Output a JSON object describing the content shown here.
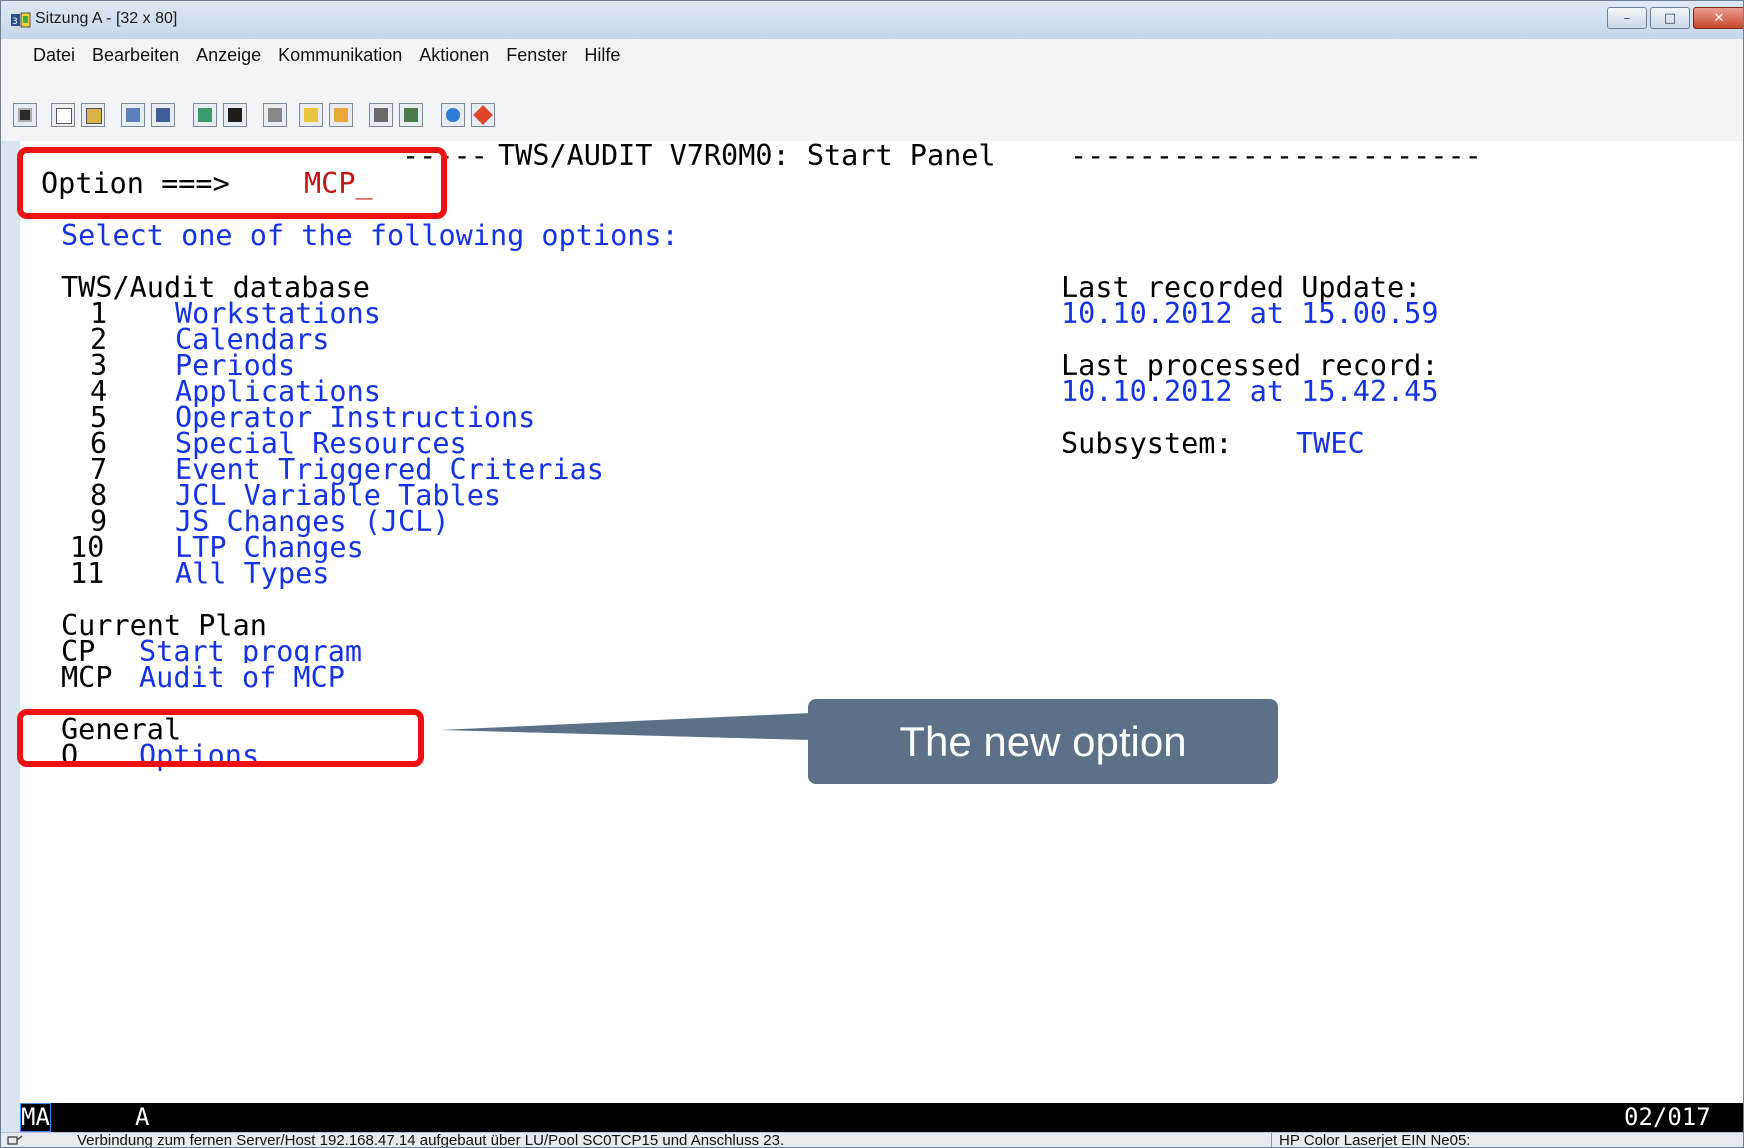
{
  "window": {
    "title": "Sitzung A - [32 x 80]",
    "buttons": {
      "minimize": "–",
      "maximize": "□",
      "close": "✕"
    }
  },
  "menu": [
    "Datei",
    "Bearbeiten",
    "Anzeige",
    "Kommunikation",
    "Aktionen",
    "Fenster",
    "Hilfe"
  ],
  "terminal": {
    "header_dashes_left": "-----",
    "panel_title": "TWS/AUDIT V7R0M0: Start Panel",
    "header_dashes_right": "------------------------",
    "option_label": "Option ===>",
    "option_value": "MCP_",
    "instruction": "Select one of the following options:",
    "db_section": "TWS/Audit database",
    "db_items": [
      {
        "num": "1",
        "label": "Workstations"
      },
      {
        "num": "2",
        "label": "Calendars"
      },
      {
        "num": "3",
        "label": "Periods"
      },
      {
        "num": "4",
        "label": "Applications"
      },
      {
        "num": "5",
        "label": "Operator Instructions"
      },
      {
        "num": "6",
        "label": "Special Resources"
      },
      {
        "num": "7",
        "label": "Event Triggered Criterias"
      },
      {
        "num": "8",
        "label": "JCL Variable Tables"
      },
      {
        "num": "9",
        "label": "JS Changes (JCL)"
      },
      {
        "num": "10",
        "label": "LTP Changes"
      },
      {
        "num": "11",
        "label": "All Types"
      }
    ],
    "last_update_label": "Last recorded Update:",
    "last_update_value": "10.10.2012 at 15.00.59",
    "last_processed_label": "Last processed record:",
    "last_processed_value": "10.10.2012 at 15.42.45",
    "subsystem_label": "Subsystem:",
    "subsystem_value": "TWEC",
    "cp_section": "Current Plan",
    "cp_items": [
      {
        "num": "CP",
        "label": "Start program"
      },
      {
        "num": "MCP",
        "label": "Audit of MCP"
      }
    ],
    "general_section": "General",
    "general_items": [
      {
        "num": "O",
        "label": "Options"
      }
    ]
  },
  "statusline": {
    "left": "MA",
    "mid": "A",
    "right": "02/017"
  },
  "statusbar": {
    "connection": "Verbindung zum fernen Server/Host 192.168.47.14 aufgebaut über LU/Pool SC0TCP15 und Anschluss 23.",
    "printer": "HP Color Laserjet EIN Ne05:"
  },
  "annotation": {
    "callout_text": "The new option"
  },
  "colors": {
    "highlight": "#ee1111",
    "callout_bg": "#5c7187",
    "field_blue": "#1433e6",
    "input_red": "#c21414"
  }
}
